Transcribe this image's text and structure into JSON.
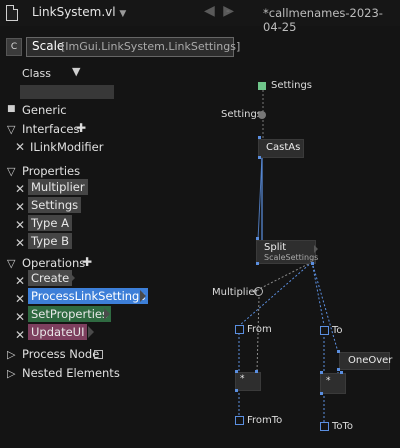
{
  "topbar": {
    "doc_title": "LinkSystem.vl",
    "caret": "▼",
    "nav_arrows": "◀ ▶",
    "nav_dash": "-",
    "doc_name": "*callmenames-2023-04-25"
  },
  "node": {
    "badge": "C",
    "name": "Scale",
    "type": "[ImGui.LinkSystem.LinkSettings]"
  },
  "class_row": {
    "label": "Class",
    "arrow": "▼",
    "input_value": ""
  },
  "sections": {
    "generic": "Generic",
    "interfaces": "Interfaces",
    "properties": "Properties",
    "operations": "Operations",
    "process_node": "Process Node",
    "nested": "Nested Elements"
  },
  "interfaces": [
    "ILinkModifier"
  ],
  "properties": [
    "Multiplier",
    "Settings",
    "Type A",
    "Type B"
  ],
  "operations": [
    "Create",
    "ProcessLinkSettings",
    "SetProperties",
    "UpdateUI"
  ],
  "glyphs": {
    "square": "■",
    "tri_down": "▽",
    "tri_right": "▷",
    "x": "✕",
    "plus": "✚"
  },
  "patch": {
    "settings_out": "Settings",
    "settings_in": "Settings",
    "castas": "CastAs",
    "split": "Split",
    "split_sub": "ScaleSettings",
    "multiplier": "Multiplier",
    "from": "From",
    "to": "To",
    "oneover": "OneOver",
    "mult_op": "*",
    "mult_op2": "*",
    "fromto": "FromTo",
    "toto": "ToTo"
  }
}
